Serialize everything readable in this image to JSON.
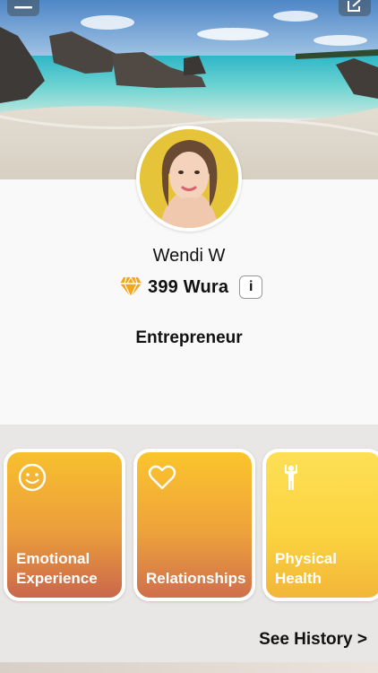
{
  "header": {
    "menu_icon": "hamburger-menu-icon",
    "edit_icon": "edit-icon"
  },
  "profile": {
    "name": "Wendi W",
    "wura_amount": "399 Wura",
    "info_label": "i",
    "role": "Entrepreneur"
  },
  "tiles": [
    {
      "label_line1": "Emotional",
      "label_line2": "Experience",
      "icon": "smiley-face-icon"
    },
    {
      "label_line1": "Relationships",
      "label_line2": "",
      "icon": "heart-icon"
    },
    {
      "label_line1": "Physical",
      "label_line2": "Health",
      "icon": "person-raising-arms-icon"
    }
  ],
  "see_history": "See History >",
  "colors": {
    "wura_diamond": "#f3a51c",
    "tile_top": "#f8c02e",
    "tile_bottom": "#c9674c"
  }
}
